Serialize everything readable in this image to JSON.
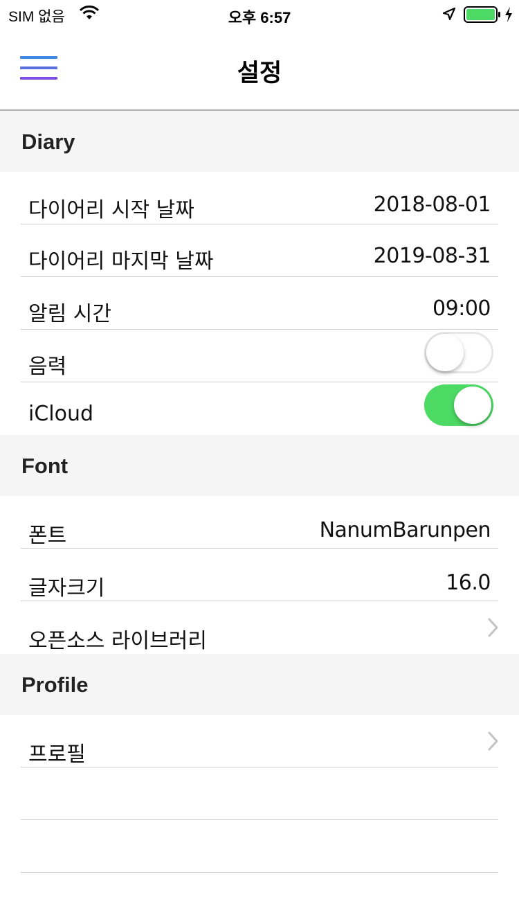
{
  "status": {
    "carrier": "SIM 없음",
    "time": "오후 6:57",
    "battery_color": "#4cd964"
  },
  "nav": {
    "title": "설정",
    "menu_icon": "hamburger-menu-icon",
    "menu_colors": [
      "#3f8ae0",
      "#5a6fe2",
      "#7b4fe6"
    ]
  },
  "sections": {
    "diary": {
      "header": "Diary",
      "start_date": {
        "label": "다이어리 시작 날짜",
        "value": "2018-08-01"
      },
      "end_date": {
        "label": "다이어리 마지막 날짜",
        "value": "2019-08-31"
      },
      "alarm_time": {
        "label": "알림 시간",
        "value": "09:00"
      },
      "lunar": {
        "label": "음력",
        "toggle": false
      },
      "icloud": {
        "label": "iCloud",
        "toggle": true
      }
    },
    "font": {
      "header": "Font",
      "font_name": {
        "label": "폰트",
        "value": "NanumBarunpen"
      },
      "font_size": {
        "label": "글자크기",
        "value": "16.0"
      },
      "open_source": {
        "label": "오픈소스 라이브러리"
      }
    },
    "profile": {
      "header": "Profile",
      "profile_item": {
        "label": "프로필"
      }
    }
  },
  "colors": {
    "toggle_on": "#4cd964",
    "section_bg": "#f5f5f5"
  }
}
